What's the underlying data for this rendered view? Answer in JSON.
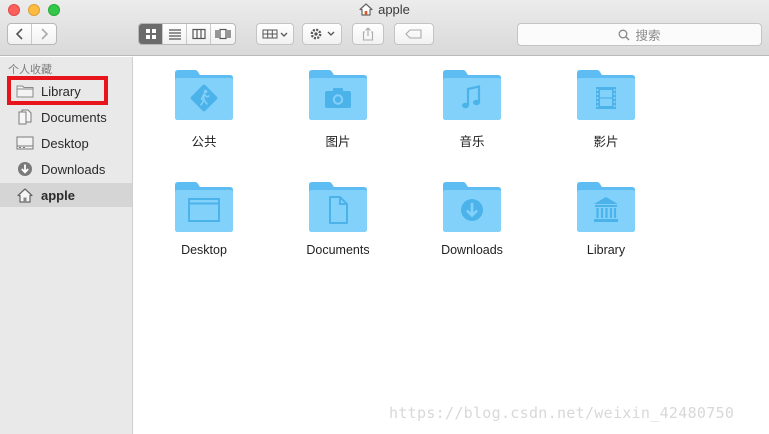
{
  "window": {
    "title": "apple"
  },
  "toolbar": {
    "back_icon": "chevron-left-icon",
    "forward_icon": "chevron-right-icon",
    "view_modes": [
      "icon-view-icon",
      "list-view-icon",
      "column-view-icon",
      "cover-flow-icon"
    ],
    "active_view": "icon-view-icon",
    "arrange_icon": "arrange-grid-icon",
    "action_icon": "gear-icon",
    "share_icon": "share-icon",
    "tags_icon": "tag-icon",
    "search": {
      "placeholder": "搜索"
    }
  },
  "sidebar": {
    "heading": "个人收藏",
    "items": [
      {
        "label": "Library",
        "icon": "folder-icon",
        "highlighted": true
      },
      {
        "label": "Documents",
        "icon": "document-icon"
      },
      {
        "label": "Desktop",
        "icon": "desktop-icon"
      },
      {
        "label": "Downloads",
        "icon": "download-icon"
      },
      {
        "label": "apple",
        "icon": "home-icon",
        "selected": true
      }
    ]
  },
  "content": {
    "items": [
      {
        "label": "公共",
        "icon": "public-folder-icon"
      },
      {
        "label": "图片",
        "icon": "pictures-folder-icon"
      },
      {
        "label": "音乐",
        "icon": "music-folder-icon"
      },
      {
        "label": "影片",
        "icon": "movies-folder-icon"
      },
      {
        "label": "Desktop",
        "icon": "desktop-folder-icon"
      },
      {
        "label": "Documents",
        "icon": "documents-folder-icon"
      },
      {
        "label": "Downloads",
        "icon": "downloads-folder-icon"
      },
      {
        "label": "Library",
        "icon": "library-folder-icon"
      }
    ]
  },
  "watermark": "https://blog.csdn.net/weixin_42480750",
  "colors": {
    "folder_light": "#7fd0f9",
    "folder_dark": "#4ab8ef",
    "highlight": "#e8141b"
  }
}
